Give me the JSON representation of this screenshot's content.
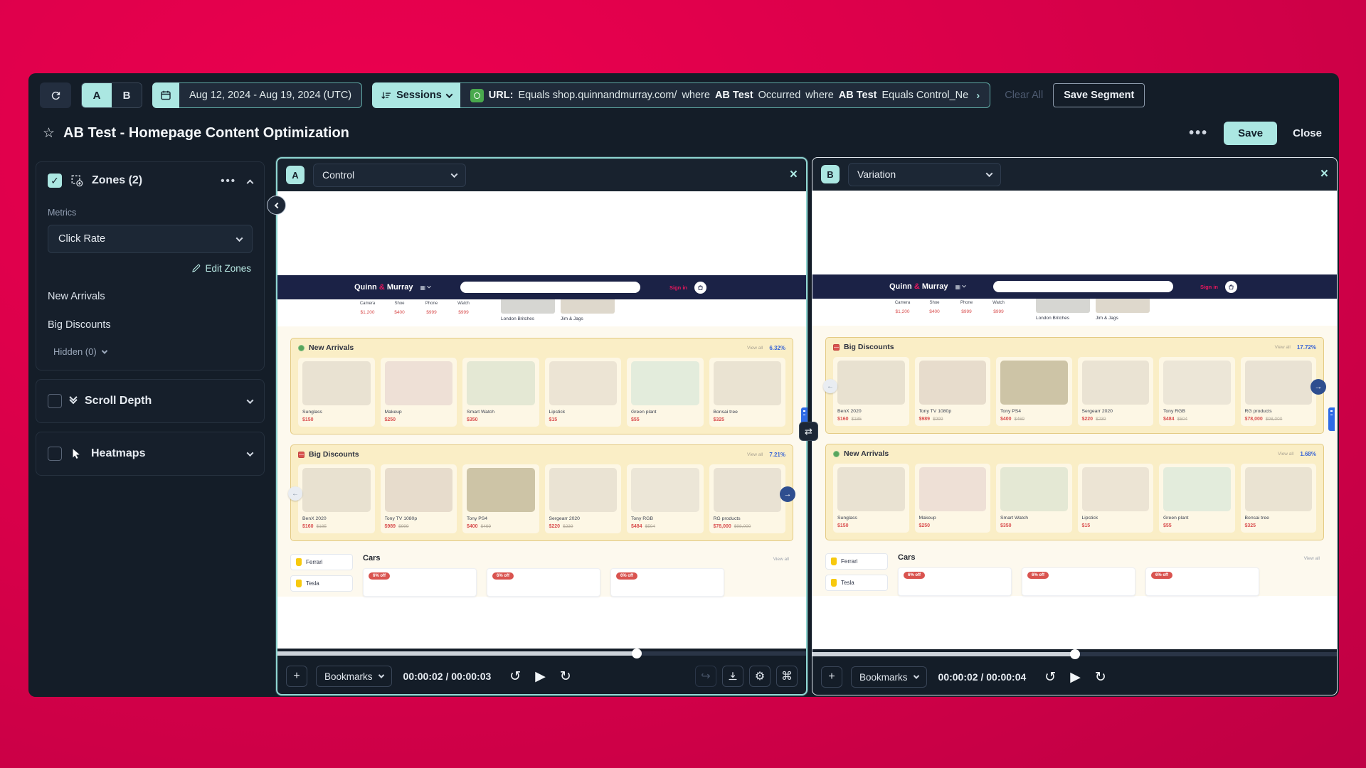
{
  "toolbar": {
    "ab_a": "A",
    "ab_b": "B",
    "date_range": "Aug 12, 2024 - Aug 19, 2024 (UTC)",
    "segment_type": "Sessions",
    "filter": {
      "url_label": "URL:",
      "url_value": "Equals shop.quinnandmurray.com/",
      "where1": "where",
      "ab1": "AB Test",
      "occurred": "Occurred",
      "where2": "where",
      "ab2": "AB Test",
      "equals_value": "Equals Control_Ne"
    },
    "clear_all": "Clear All",
    "save_segment": "Save Segment"
  },
  "header": {
    "title": "AB Test - Homepage Content Optimization",
    "menu": "•••",
    "save": "Save",
    "close": "Close"
  },
  "sidebar": {
    "zones": {
      "title": "Zones (2)",
      "metrics_label": "Metrics",
      "metric": "Click Rate",
      "edit": "Edit Zones",
      "items": [
        "New Arrivals",
        "Big Discounts"
      ],
      "hidden": "Hidden (0)"
    },
    "scroll_depth": "Scroll Depth",
    "heatmaps": "Heatmaps"
  },
  "panels": [
    {
      "badge": "A",
      "variant": "Control",
      "na_pct": "6.32%",
      "bd_pct": "7.21%",
      "bookmarks": "Bookmarks",
      "time": "00:00:02 / 00:00:03",
      "progress": 68
    },
    {
      "badge": "B",
      "variant": "Variation",
      "na_pct": "1.68%",
      "bd_pct": "17.72%",
      "bookmarks": "Bookmarks",
      "time": "00:00:02 / 00:00:04",
      "progress": 50
    }
  ],
  "site": {
    "brand_1": "Quinn",
    "brand_amp": "&",
    "brand_2": "Murray",
    "sign_in": "Sign in",
    "view_all": "View all",
    "strip": {
      "products": [
        {
          "name": "Camera",
          "price": "$1,200"
        },
        {
          "name": "Shoe",
          "price": "$400"
        },
        {
          "name": "Phone",
          "price": "$999"
        },
        {
          "name": "Watch",
          "price": "$999"
        }
      ],
      "shops": [
        {
          "name": "London Britches",
          "img": "#d6d6d2"
        },
        {
          "name": "Jim & Jags",
          "img": "#ded8cc"
        }
      ]
    },
    "new_arrivals": {
      "title": "New Arrivals",
      "products": [
        {
          "name": "Sunglass",
          "price": "$150",
          "img": "#e9e2d2"
        },
        {
          "name": "Makeup",
          "price": "$250",
          "img": "#eee0d6"
        },
        {
          "name": "Smart Watch",
          "price": "$350",
          "img": "#e4e8d4"
        },
        {
          "name": "Lipstick",
          "price": "$15",
          "img": "#ece4d4"
        },
        {
          "name": "Green plant",
          "price": "$55",
          "img": "#e3ecdc"
        },
        {
          "name": "Bonsai tree",
          "price": "$325",
          "img": "#eae3d2"
        }
      ]
    },
    "big_discounts": {
      "title": "Big Discounts",
      "products": [
        {
          "name": "BenX 2020",
          "price": "$160",
          "old": "$185",
          "img": "#e8e1d0"
        },
        {
          "name": "Tony TV 1080p",
          "price": "$989",
          "old": "$999",
          "img": "#e7dccc"
        },
        {
          "name": "Tony PS4",
          "price": "$400",
          "old": "$469",
          "img": "#cdc4a6"
        },
        {
          "name": "Sergearr 2020",
          "price": "$220",
          "old": "$239",
          "img": "#eae3d3"
        },
        {
          "name": "Tony RGB",
          "price": "$484",
          "old": "$504",
          "img": "#ece6d7"
        },
        {
          "name": "RG products",
          "price": "$78,000",
          "old": "$98,000",
          "img": "#e9e2d3"
        }
      ]
    },
    "cars": {
      "title": "Cars",
      "view_all": "View all",
      "brands": [
        {
          "name": "Ferrari"
        },
        {
          "name": "Tesla"
        }
      ],
      "cards": [
        {
          "badge": "6% off"
        },
        {
          "badge": "6% off"
        },
        {
          "badge": "6% off"
        }
      ]
    }
  },
  "colors": {
    "accent_teal": "#ABE7E2",
    "crimson_bg": "#D60049",
    "zone_fill": "#FAEEC6",
    "zone_border": "#E3CA83",
    "price_red": "#D94F4F",
    "pct_blue": "#3A66D6",
    "filter_icon_green": "#49A94D"
  }
}
